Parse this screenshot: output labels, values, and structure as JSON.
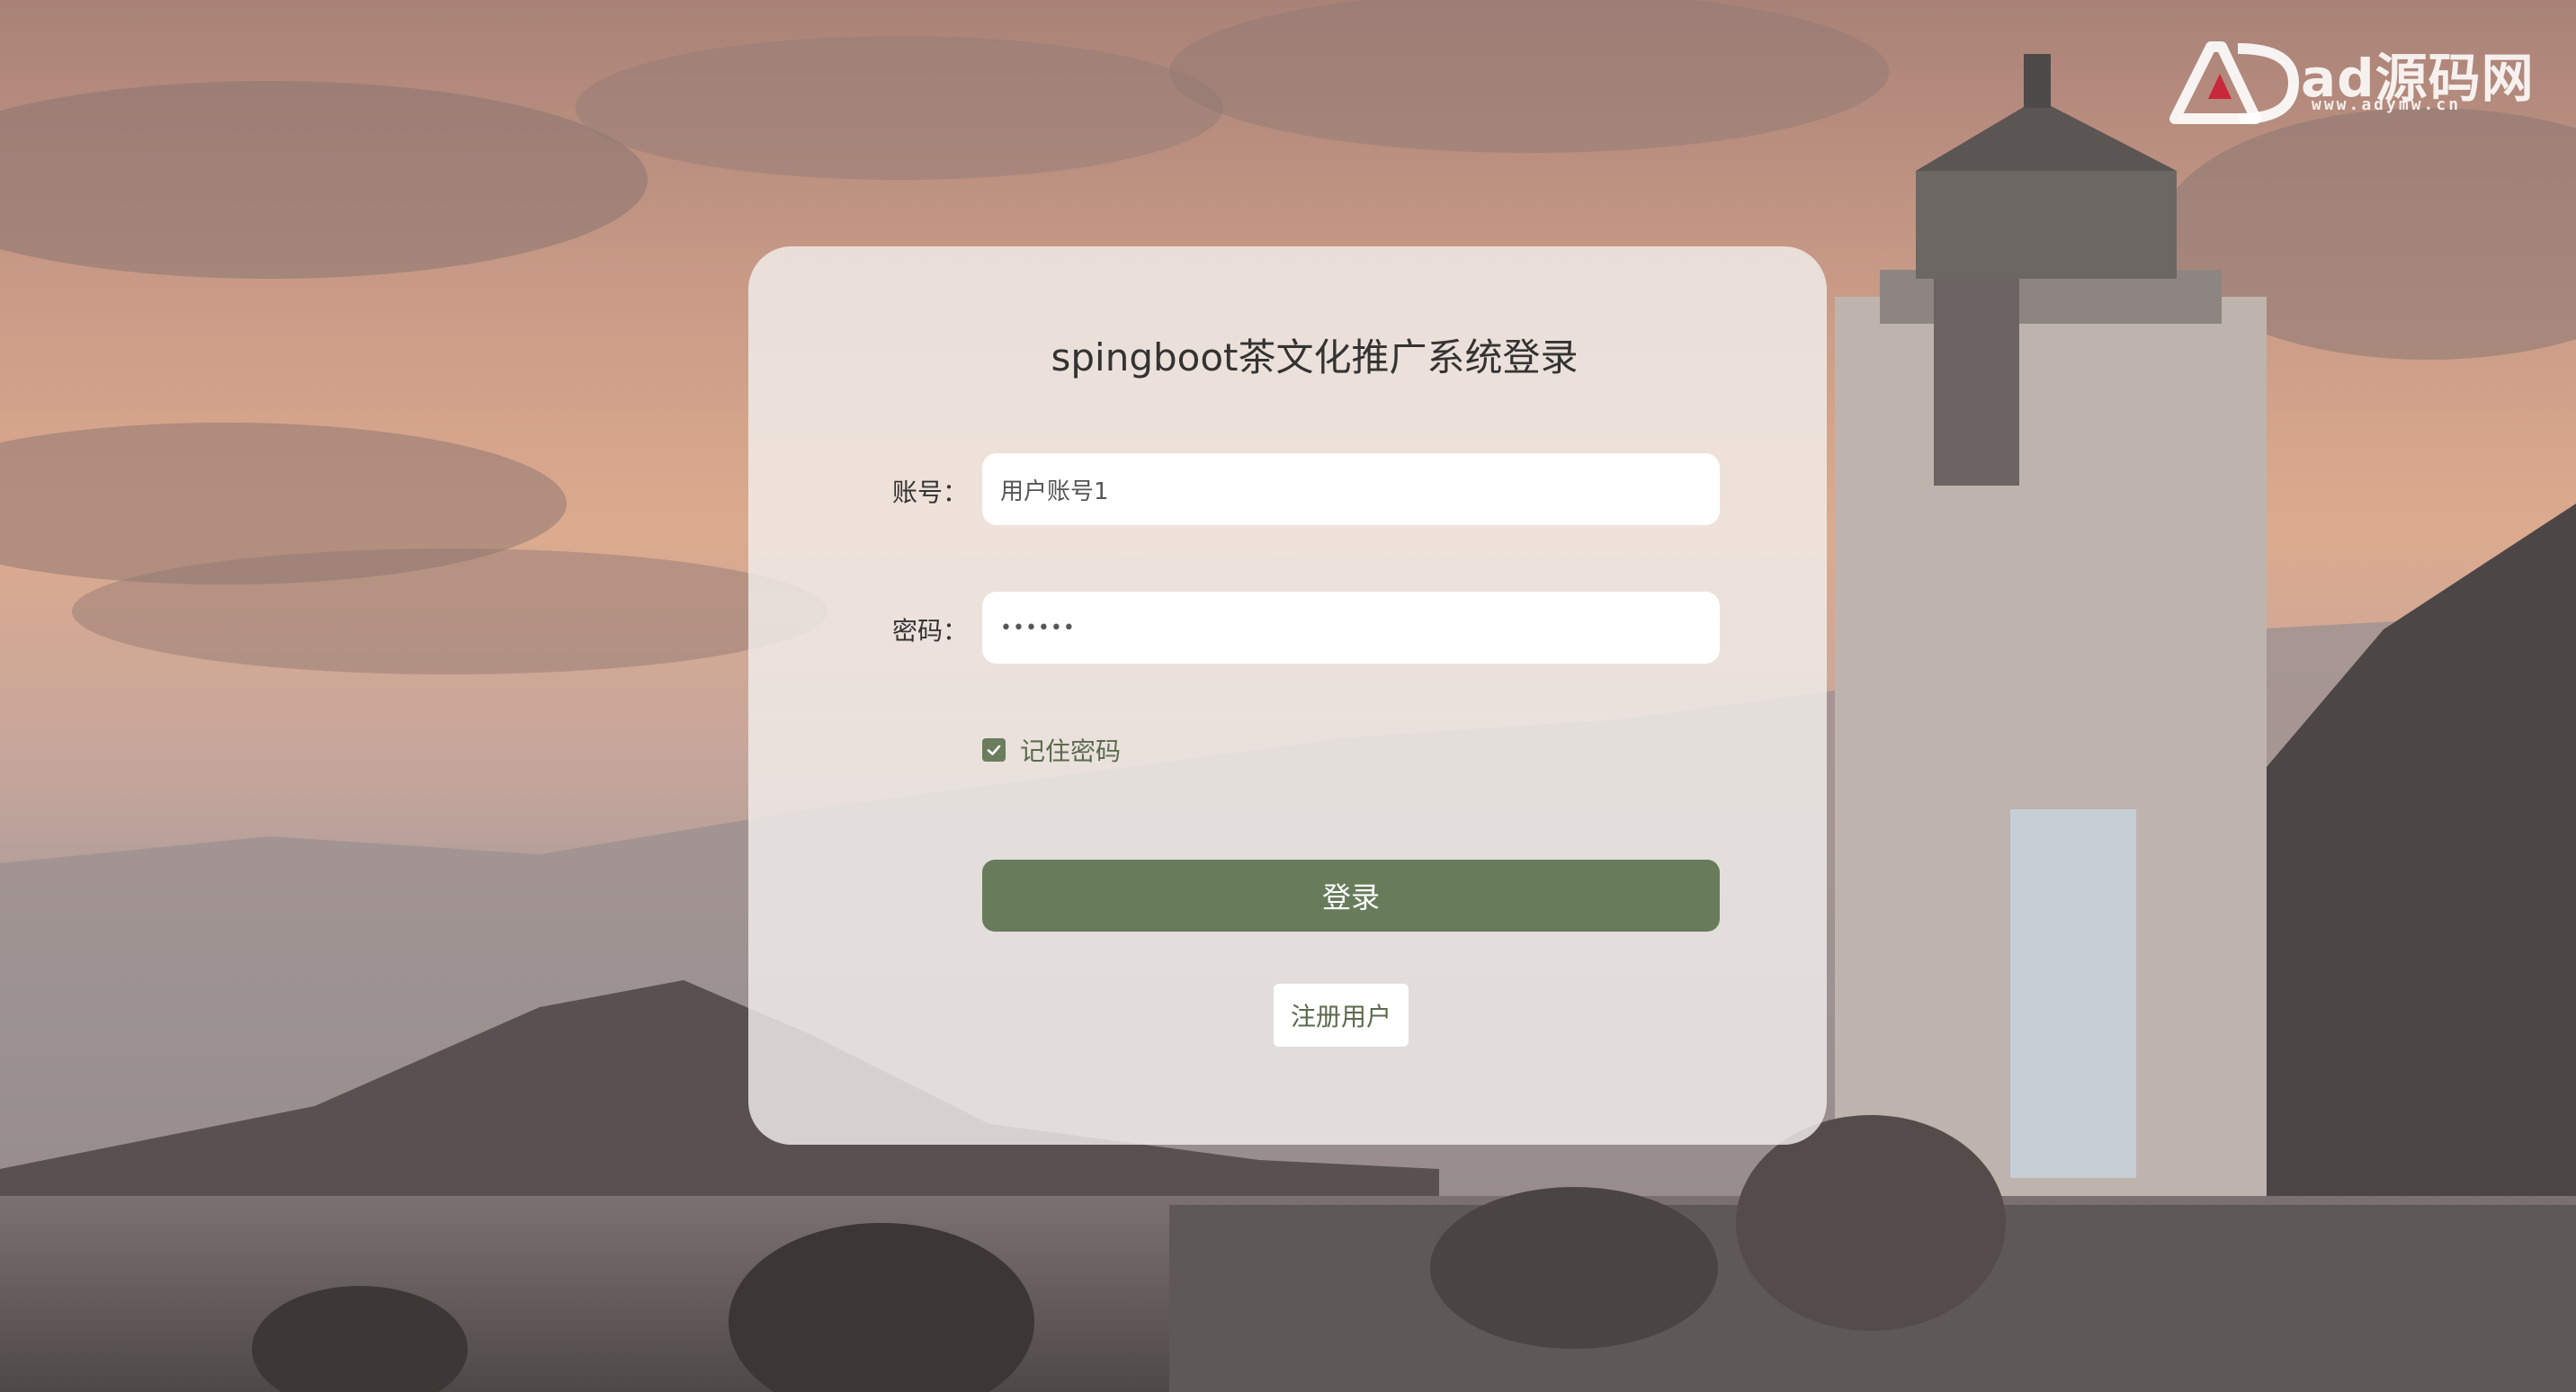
{
  "watermark": {
    "brand": "ad源码网",
    "url": "www.adymw.cn"
  },
  "login": {
    "title": "spingboot茶文化推广系统登录",
    "account_label": "账号：",
    "account_placeholder": "用户账号1",
    "password_label": "密码：",
    "password_value": "••••••",
    "remember_label": "记住密码",
    "remember_checked": true,
    "login_button": "登录",
    "register_button": "注册用户"
  },
  "colors": {
    "primary": "#687c5b",
    "checkbox": "#6b7d5c",
    "text": "#333333"
  }
}
